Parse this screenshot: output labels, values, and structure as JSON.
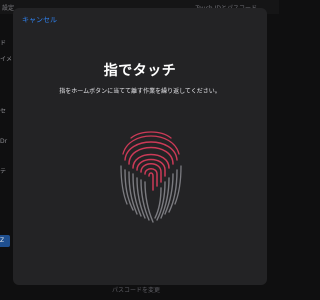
{
  "background": {
    "settings_label": "設定",
    "right_title": "Touch IDとパスコード",
    "left_items": [
      "ド",
      "イメ",
      "セ",
      "Dr",
      "テ",
      "Z"
    ],
    "bottom_link": "パスコードを変更"
  },
  "sheet": {
    "cancel_label": "キャンセル",
    "title": "指でタッチ",
    "instruction": "指をホームボタンに当てて離す作業を繰り返してください。"
  },
  "colors": {
    "sheet_bg": "#232325",
    "fingerprint_red": "#cc3a57",
    "fingerprint_gray": "#7b7b80",
    "link_blue": "#2f80ed"
  },
  "icons": {
    "fingerprint": "fingerprint-icon"
  }
}
